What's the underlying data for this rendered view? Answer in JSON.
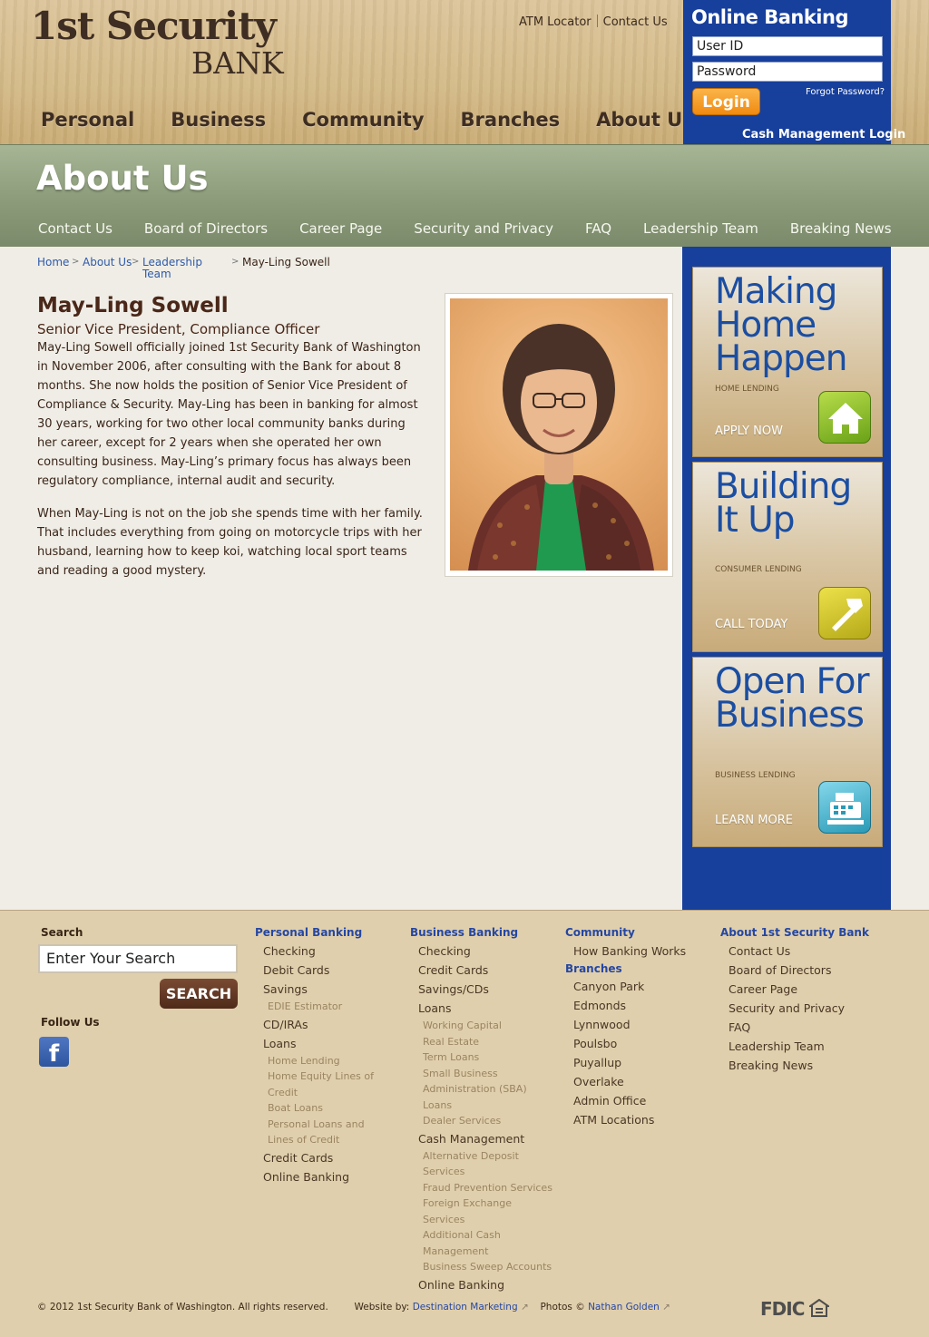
{
  "header": {
    "logo_line1": "1st Security",
    "logo_line2": "BANK",
    "util_links": [
      "ATM Locator",
      "Contact Us"
    ],
    "main_nav": [
      "Personal",
      "Business",
      "Community",
      "Branches",
      "About Us"
    ]
  },
  "online_banking": {
    "title": "Online Banking",
    "user_placeholder": "User ID",
    "pass_placeholder": "Password",
    "login_label": "Login",
    "forgot_label": "Forgot Password?",
    "cash_mgmt_label": "Cash Management Login"
  },
  "section": {
    "title": "About Us",
    "sub_nav": [
      "Contact Us",
      "Board of Directors",
      "Career Page",
      "Security and Privacy",
      "FAQ",
      "Leadership Team",
      "Breaking News"
    ]
  },
  "breadcrumb": {
    "home": "Home",
    "about": "About Us",
    "leadership_line1": "Leadership",
    "leadership_line2": "Team",
    "current": "May-Ling Sowell",
    "sep": ">"
  },
  "profile": {
    "name": "May-Ling Sowell",
    "title": "Senior Vice President, Compliance Officer",
    "bio_1": "May-Ling Sowell officially joined 1st Security Bank of Washington in November 2006, after consulting with the Bank for about 8 months. She now holds the position of Senior Vice President of Compliance & Security. May-Ling has been in banking for almost 30 years, working for two other local community banks during her career, except for 2 years when she operated her own consulting business. May-Ling’s primary focus has always been regulatory compliance, internal audit and security.",
    "bio_2": "When May-Ling is not on the job she spends time with her family. That includes everything from going on motorcycle trips with her husband, learning how to keep koi, watching local sport teams and reading a good mystery."
  },
  "promos": [
    {
      "headline": "Making Home Happen",
      "category": "HOME LENDING",
      "cta": "APPLY NOW",
      "icon": "house-icon"
    },
    {
      "headline": "Building It Up",
      "category": "CONSUMER LENDING",
      "cta": "CALL TODAY",
      "icon": "hammer-icon"
    },
    {
      "headline": "Open For Business",
      "category": "BUSINESS LENDING",
      "cta": "LEARN MORE",
      "icon": "cash-register-icon"
    }
  ],
  "footer": {
    "search_label": "Search",
    "search_placeholder": "Enter Your Search",
    "search_button": "SEARCH",
    "follow_label": "Follow Us",
    "fb_letter": "f",
    "personal": {
      "heading": "Personal Banking",
      "items": [
        "Checking",
        "Debit Cards",
        "Savings"
      ],
      "savings_sub": [
        "EDIE Estimator"
      ],
      "items_b": [
        "CD/IRAs",
        "Loans"
      ],
      "loans_sub": [
        "Home Lending",
        "Home Equity Lines of Credit",
        "Boat Loans",
        "Personal Loans and Lines of Credit"
      ],
      "items_c": [
        "Credit Cards",
        "Online Banking"
      ]
    },
    "business": {
      "heading": "Business Banking",
      "items": [
        "Checking",
        "Credit Cards",
        "Savings/CDs",
        "Loans"
      ],
      "loans_sub": [
        "Working Capital",
        "Real Estate",
        "Term Loans",
        "Small Business Administration (SBA) Loans",
        "Dealer Services"
      ],
      "cash_mgmt": "Cash Management",
      "cash_sub": [
        "Alternative Deposit Services",
        "Fraud Prevention Services",
        "Foreign Exchange Services",
        "Additional Cash Management",
        "Business Sweep Accounts"
      ],
      "online": "Online Banking"
    },
    "community": {
      "heading": "Community",
      "items": [
        "How Banking Works"
      ],
      "branches_heading": "Branches",
      "branches": [
        "Canyon Park",
        "Edmonds",
        "Lynnwood",
        "Poulsbo",
        "Puyallup",
        "Overlake",
        "Admin Office",
        "ATM Locations"
      ]
    },
    "about": {
      "heading": "About 1st Security Bank",
      "items": [
        "Contact Us",
        "Board of Directors",
        "Career Page",
        "Security and Privacy",
        "FAQ",
        "Leadership Team",
        "Breaking News"
      ]
    },
    "copyright": "© 2012 1st Security Bank of Washington. All rights reserved.",
    "website_by_label": "Website by:",
    "website_by": "Destination Marketing",
    "photos_label": "Photos ©",
    "photographer": "Nathan Golden",
    "fdic": "FDIC"
  }
}
